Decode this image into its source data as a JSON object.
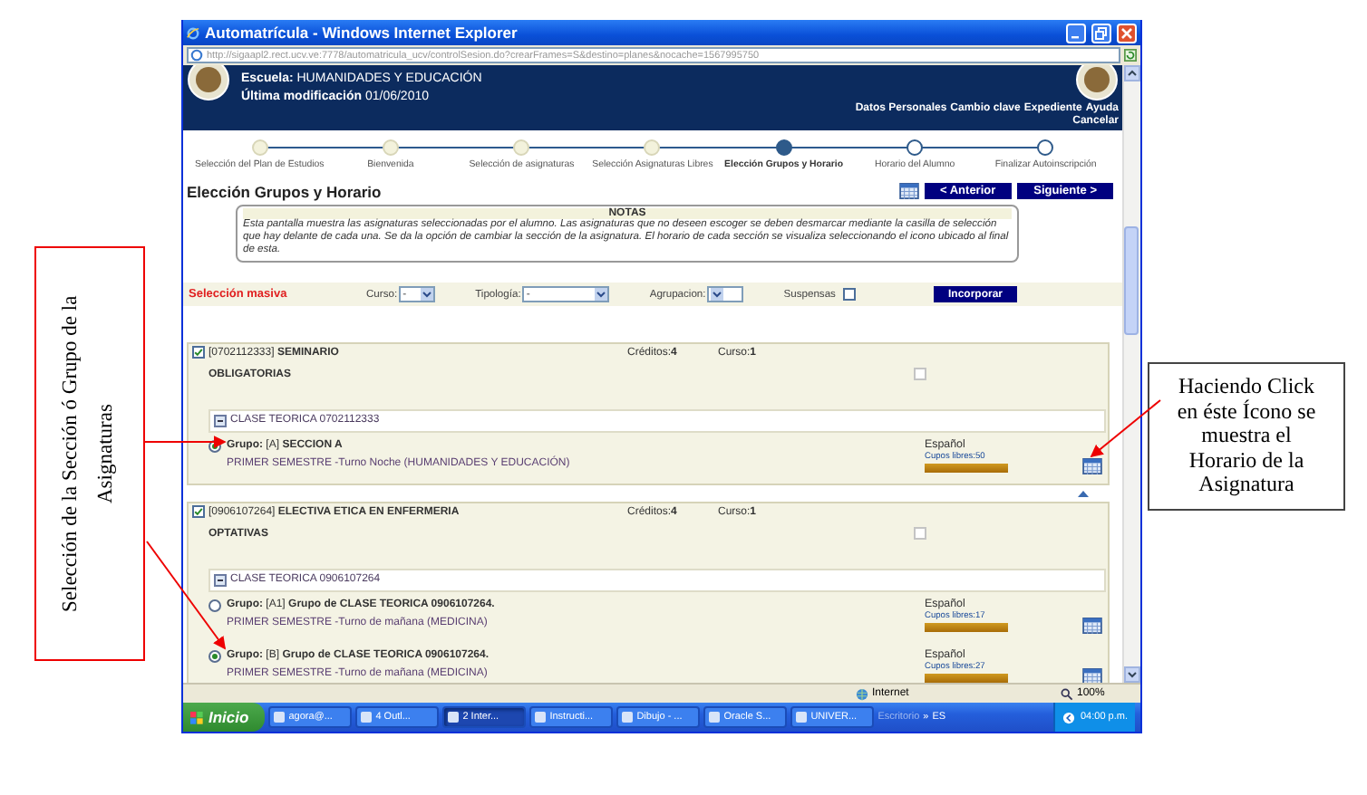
{
  "callouts": {
    "left": "Selección de la Sección ó Grupo de la Asignaturas",
    "right": "Haciendo Click en éste Ícono se muestra el Horario de la Asignatura"
  },
  "window": {
    "title": "Automatrícula - Windows Internet Explorer",
    "address": "http://sigaapl2.rect.ucv.ve:7778/automatricula_ucv/controlSesion.do?crearFrames=S&destino=planes&nocache=1567995750"
  },
  "header": {
    "school_label": "Escuela:",
    "school": "HUMANIDADES Y EDUCACIÓN",
    "modified_label": "Última modificación",
    "modified": "01/06/2010",
    "links": [
      "Datos Personales",
      "Cambio clave",
      "Expediente",
      "Ayuda"
    ],
    "cancel": "Cancelar"
  },
  "steps": [
    {
      "label": "Selección del Plan de Estudios",
      "completed": true,
      "current": false
    },
    {
      "label": "Bienvenida",
      "completed": true,
      "current": false
    },
    {
      "label": "Selección de asignaturas",
      "completed": true,
      "current": false
    },
    {
      "label": "Selección Asignaturas Libres",
      "completed": true,
      "current": false
    },
    {
      "label": "Elección Grupos y Horario",
      "completed": false,
      "current": true
    },
    {
      "label": "Horario del Alumno",
      "completed": false,
      "current": false
    },
    {
      "label": "Finalizar Autoinscripción",
      "completed": false,
      "current": false
    }
  ],
  "page_title": "Elección Grupos y Horario",
  "nav_buttons": [
    "< Anterior",
    "Siguiente >"
  ],
  "notes": {
    "title": "NOTAS",
    "text": "Esta pantalla muestra las asignaturas seleccionadas por el alumno. Las asignaturas que no deseen escoger se deben desmarcar mediante la casilla de selección que hay delante de cada una. Se da la opción de cambiar la sección de la asignatura. El horario de cada sección se visualiza seleccionando el icono ubicado al final de esta."
  },
  "bulk": {
    "label": "Selección masiva",
    "filters": [
      {
        "kind": "select",
        "label": "Curso:",
        "value": "-"
      },
      {
        "kind": "select",
        "label": "Tipología:",
        "value": "-"
      },
      {
        "kind": "select",
        "label": "Agrupacion:"
      },
      {
        "kind": "checkbox",
        "label": "Suspensas",
        "checked": false
      }
    ],
    "button": "Incorporar"
  },
  "subjects": [
    {
      "checked": true,
      "code": "[0702112333]",
      "name": "SEMINARIO",
      "credits_label": "Créditos:",
      "credits": "4",
      "course_label": "Curso:",
      "course": "1",
      "type": "OBLIGATORIAS",
      "flag_checked": false,
      "class_title": "CLASE TEORICA 0702112333",
      "groups": [
        {
          "selected": true,
          "label": "Grupo:",
          "code": "[A]",
          "name": "SECCION A",
          "schedule": "PRIMER SEMESTRE -Turno Noche (HUMANIDADES Y EDUCACIÓN)",
          "language": "Español",
          "seats": "Cupos libres:50",
          "level": 1
        }
      ]
    },
    {
      "checked": true,
      "code": "[0906107264]",
      "name": "ELECTIVA ETICA EN ENFERMERIA",
      "credits_label": "Créditos:",
      "credits": "4",
      "course_label": "Curso:",
      "course": "1",
      "type": "OPTATIVAS",
      "flag_checked": false,
      "class_title": "CLASE TEORICA 0906107264",
      "groups": [
        {
          "selected": false,
          "label": "Grupo:",
          "code": "[A1]",
          "name": "Grupo de CLASE TEORICA 0906107264.",
          "schedule": "PRIMER SEMESTRE -Turno de mañana (MEDICINA)",
          "language": "Español",
          "seats": "Cupos libres:17",
          "level": 1
        },
        {
          "selected": true,
          "label": "Grupo:",
          "code": "[B]",
          "name": "Grupo de CLASE TEORICA 0906107264.",
          "schedule": "PRIMER SEMESTRE -Turno de mañana (MEDICINA)",
          "language": "Español",
          "seats": "Cupos libres:27",
          "level": 1
        }
      ]
    }
  ],
  "status_bar": {
    "zone": "Internet",
    "zoom": "100%"
  },
  "taskbar": {
    "start": "Inicio",
    "items": [
      {
        "label": "agora@...",
        "selected": false
      },
      {
        "label": "4 Outl...",
        "selected": false
      },
      {
        "label": "2 Inter...",
        "selected": true
      },
      {
        "label": "Instructi...",
        "selected": false
      },
      {
        "label": "Dibujo - ...",
        "selected": false
      },
      {
        "label": "Oracle S...",
        "selected": false
      },
      {
        "label": "UNIVER...",
        "selected": false
      }
    ],
    "toolbar": "Escritorio",
    "more": "»",
    "language": "ES",
    "clock": "04:00 p.m."
  }
}
